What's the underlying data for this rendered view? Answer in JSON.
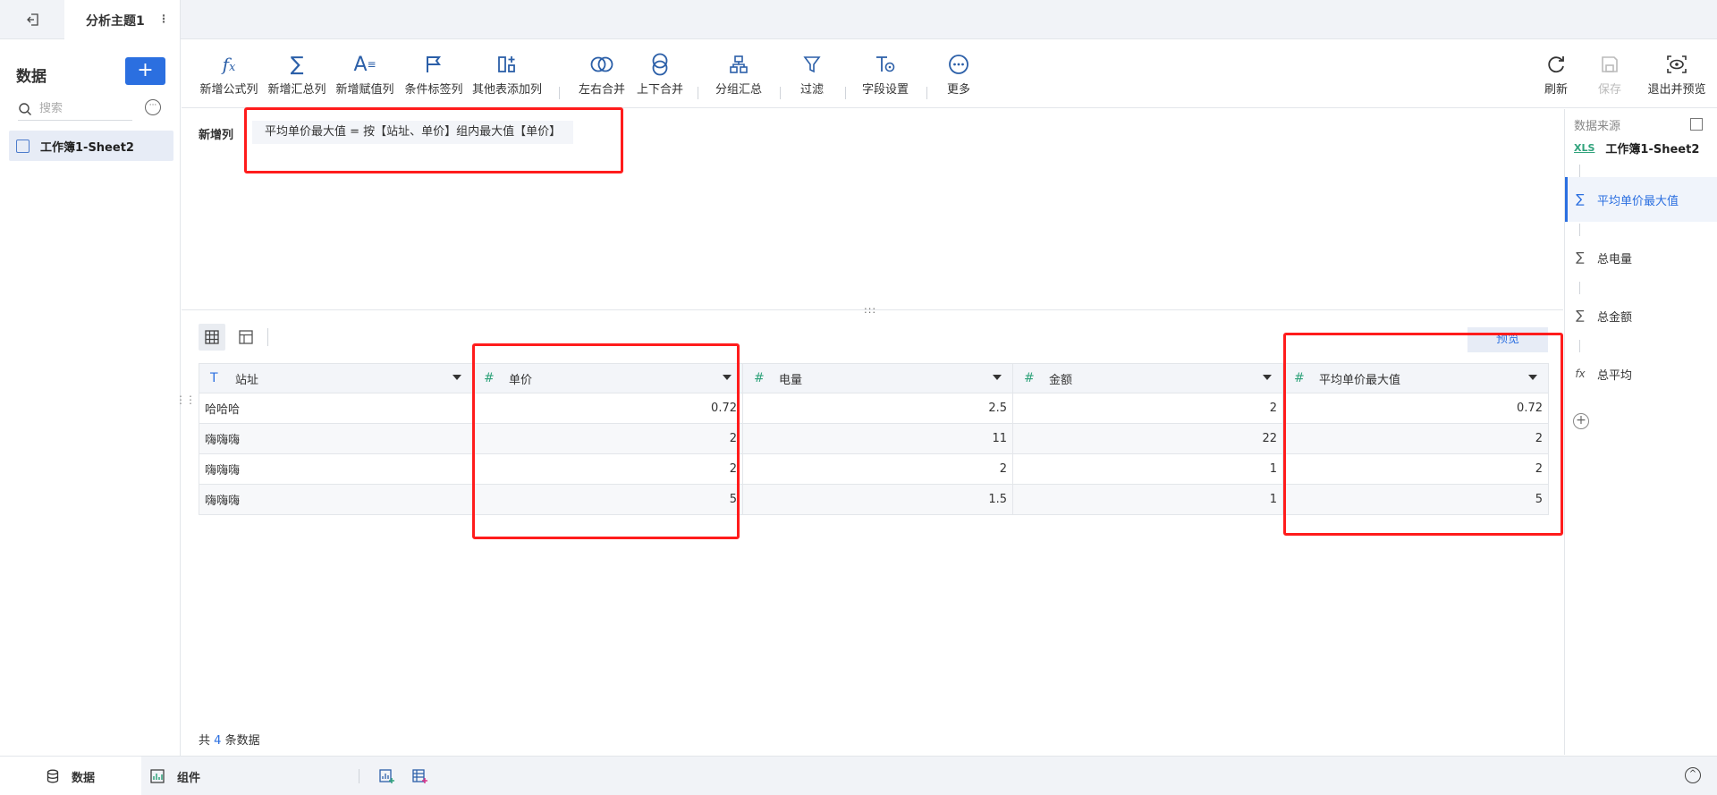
{
  "topbar": {
    "tab_title": "分析主题1",
    "tab_menu": "⋮"
  },
  "sidebar": {
    "title": "数据",
    "add_label": "+",
    "search_placeholder": "搜索",
    "items": [
      {
        "label": "工作簿1-Sheet2"
      }
    ]
  },
  "toolbar": {
    "items": [
      {
        "label": "新增公式列",
        "icon": "formula-icon"
      },
      {
        "label": "新增汇总列",
        "icon": "sigma-icon"
      },
      {
        "label": "新增赋值列",
        "icon": "assign-icon"
      },
      {
        "label": "条件标签列",
        "icon": "flag-icon"
      },
      {
        "label": "其他表添加列",
        "icon": "add-column-icon"
      },
      {
        "label": "左右合并",
        "icon": "merge-lr-icon"
      },
      {
        "label": "上下合并",
        "icon": "merge-ud-icon"
      },
      {
        "label": "分组汇总",
        "icon": "group-icon"
      },
      {
        "label": "过滤",
        "icon": "filter-icon"
      },
      {
        "label": "字段设置",
        "icon": "field-settings-icon"
      },
      {
        "label": "更多",
        "icon": "more-icon"
      }
    ],
    "right": [
      {
        "label": "刷新",
        "icon": "refresh-icon"
      },
      {
        "label": "保存",
        "icon": "save-icon"
      },
      {
        "label": "退出并预览",
        "icon": "exit-preview-icon"
      }
    ]
  },
  "formula": {
    "label": "新增列",
    "expression": "平均单价最大值 = 按【站址、单价】组内最大值【单价】"
  },
  "table": {
    "preview_label": "预览",
    "columns": [
      {
        "name": "站址",
        "type": "text"
      },
      {
        "name": "单价",
        "type": "number"
      },
      {
        "name": "电量",
        "type": "number"
      },
      {
        "name": "金额",
        "type": "number"
      },
      {
        "name": "平均单价最大值",
        "type": "number"
      }
    ],
    "rows": [
      [
        "哈哈哈",
        "0.72",
        "2.5",
        "2",
        "0.72"
      ],
      [
        "嗨嗨嗨",
        "2",
        "11",
        "22",
        "2"
      ],
      [
        "嗨嗨嗨",
        "2",
        "2",
        "1",
        "2"
      ],
      [
        "嗨嗨嗨",
        "5",
        "1.5",
        "1",
        "5"
      ]
    ],
    "count_prefix": "共",
    "count": "4",
    "count_suffix": "条数据"
  },
  "right_panel": {
    "header": "数据来源",
    "source_badge": "XLS",
    "source": "工作簿1-Sheet2",
    "steps": [
      {
        "label": "平均单价最大值",
        "icon": "∑",
        "active": true
      },
      {
        "label": "总电量",
        "icon": "∑",
        "active": false
      },
      {
        "label": "总金额",
        "icon": "∑",
        "active": false
      },
      {
        "label": "总平均",
        "icon": "fx",
        "active": false
      }
    ]
  },
  "bottombar": {
    "tabs": [
      {
        "label": "数据"
      },
      {
        "label": "组件"
      }
    ]
  },
  "colors": {
    "accent": "#2b6fe0",
    "highlight": "#ff1c1c",
    "number_type": "#31a37c"
  }
}
